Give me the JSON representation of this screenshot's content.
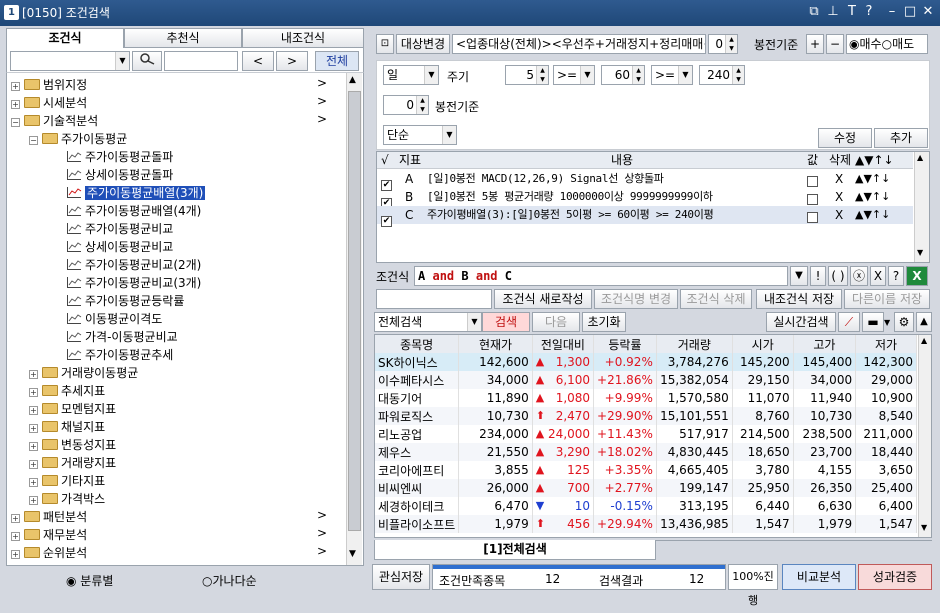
{
  "window": {
    "icon": "1",
    "title": "[0150] 조건검색",
    "buttons": [
      "⧉",
      "⊥",
      "T",
      "?",
      "–",
      "□",
      "✕"
    ]
  },
  "left": {
    "tabs": [
      "조건식",
      "추천식",
      "내조건식"
    ],
    "prev_label": "<",
    "next_label": ">",
    "all_label": "전체",
    "tree": [
      {
        "label": "범위지정",
        "level": 0,
        "type": "folder",
        "exp": "+",
        "arrow": ">"
      },
      {
        "label": "시세분석",
        "level": 0,
        "type": "folder",
        "exp": "+",
        "arrow": ">"
      },
      {
        "label": "기술적분석",
        "level": 0,
        "type": "folder",
        "exp": "−",
        "arrow": ">"
      },
      {
        "label": "주가이동평균",
        "level": 1,
        "type": "folder",
        "exp": "−"
      },
      {
        "label": "주가이동평균돌파",
        "level": 2,
        "type": "item"
      },
      {
        "label": "상세이동평균돌파",
        "level": 2,
        "type": "item"
      },
      {
        "label": "주가이동평균배열(3개)",
        "level": 2,
        "type": "item",
        "selected": true
      },
      {
        "label": "주가이동평균배열(4개)",
        "level": 2,
        "type": "item"
      },
      {
        "label": "주가이동평균비교",
        "level": 2,
        "type": "item"
      },
      {
        "label": "상세이동평균비교",
        "level": 2,
        "type": "item"
      },
      {
        "label": "주가이동평균비교(2개)",
        "level": 2,
        "type": "item"
      },
      {
        "label": "주가이동평균비교(3개)",
        "level": 2,
        "type": "item"
      },
      {
        "label": "주가이동평균등락률",
        "level": 2,
        "type": "item"
      },
      {
        "label": "이동평균이격도",
        "level": 2,
        "type": "item"
      },
      {
        "label": "가격-이동평균비교",
        "level": 2,
        "type": "item"
      },
      {
        "label": "주가이동평균추세",
        "level": 2,
        "type": "item"
      },
      {
        "label": "거래량이동평균",
        "level": 1,
        "type": "folder",
        "exp": "+"
      },
      {
        "label": "추세지표",
        "level": 1,
        "type": "folder",
        "exp": "+"
      },
      {
        "label": "모멘텀지표",
        "level": 1,
        "type": "folder",
        "exp": "+"
      },
      {
        "label": "채널지표",
        "level": 1,
        "type": "folder",
        "exp": "+"
      },
      {
        "label": "변동성지표",
        "level": 1,
        "type": "folder",
        "exp": "+"
      },
      {
        "label": "거래량지표",
        "level": 1,
        "type": "folder",
        "exp": "+"
      },
      {
        "label": "기타지표",
        "level": 1,
        "type": "folder",
        "exp": "+"
      },
      {
        "label": "가격박스",
        "level": 1,
        "type": "folder",
        "exp": "+"
      },
      {
        "label": "패턴분석",
        "level": 0,
        "type": "folder",
        "exp": "+",
        "arrow": ">"
      },
      {
        "label": "재무분석",
        "level": 0,
        "type": "folder",
        "exp": "+",
        "arrow": ">"
      },
      {
        "label": "순위분석",
        "level": 0,
        "type": "folder",
        "exp": "+",
        "arrow": ">"
      }
    ],
    "radio1": "분류별",
    "radio2": "가나다순"
  },
  "right": {
    "scope_btn": "대상변경",
    "scope_text": "<업종대상(전체)><우선주+거래정지+정리매매+",
    "scope_num": "0",
    "scope_basis": "봉전기준",
    "plus": "+",
    "minus": "−",
    "buy": "매수",
    "sell": "매도",
    "period_sel": "일",
    "period_label": "주기",
    "ma1": "5",
    "op1": ">=",
    "ma2": "60",
    "op2": ">=",
    "ma3": "240",
    "offset": "0",
    "offset_label": "봉전기준",
    "type_sel": "단순",
    "edit_btn": "수정",
    "add_btn": "추가",
    "cond_headers": [
      "√",
      "지표",
      "내용",
      "값",
      "삭제",
      "▲▼↑↓"
    ],
    "conditions": [
      {
        "id": "A",
        "text": "[일]0봉전 MACD(12,26,9) Signal선 상향돌파",
        "del": "X",
        "sel": false
      },
      {
        "id": "B",
        "text": "[일]0봉전 5봉 평균거래량 1000000이상 9999999999이하",
        "del": "X",
        "sel": false
      },
      {
        "id": "C",
        "text": "주가이평배열(3):[일]0봉전 5이평 >= 60이평 >= 240이평",
        "del": "X",
        "sel": true
      }
    ],
    "formula_label": "조건식",
    "formula": "A and B and C",
    "f_btns": [
      "▼",
      "!",
      "( )",
      "ⓧ",
      "X",
      "?"
    ],
    "act_btns": [
      "조건식 새로작성",
      "조건식명 변경",
      "조건식 삭제",
      "내조건식 저장",
      "다른이름 저장"
    ],
    "search_scope": "전체검색",
    "search_btn": "검색",
    "next_btn": "다음",
    "reset_btn": "초기화",
    "realtime_btn": "실시간검색",
    "table_headers": [
      "종목명",
      "현재가",
      "전일대비",
      "등락률",
      "거래량",
      "시가",
      "고가",
      "저가"
    ],
    "rows": [
      {
        "name": "SK하이닉스",
        "price": "142,600",
        "arrow": "▲",
        "diff": "1,300",
        "rate": "+0.92%",
        "vol": "3,784,276",
        "open": "145,200",
        "high": "145,400",
        "low": "142,300",
        "up": true,
        "limit": false
      },
      {
        "name": "이수페타시스",
        "price": "34,000",
        "arrow": "▲",
        "diff": "6,100",
        "rate": "+21.86%",
        "vol": "15,382,054",
        "open": "29,150",
        "high": "34,000",
        "low": "29,000",
        "up": true,
        "limit": false
      },
      {
        "name": "대동기어",
        "price": "11,890",
        "arrow": "▲",
        "diff": "1,080",
        "rate": "+9.99%",
        "vol": "1,570,580",
        "open": "11,070",
        "high": "11,940",
        "low": "10,900",
        "up": true,
        "limit": false
      },
      {
        "name": "파워로직스",
        "price": "10,730",
        "arrow": "⬆",
        "diff": "2,470",
        "rate": "+29.90%",
        "vol": "15,101,551",
        "open": "8,760",
        "high": "10,730",
        "low": "8,540",
        "up": true,
        "limit": true
      },
      {
        "name": "리노공업",
        "price": "234,000",
        "arrow": "▲",
        "diff": "24,000",
        "rate": "+11.43%",
        "vol": "517,917",
        "open": "214,500",
        "high": "238,500",
        "low": "211,000",
        "up": true,
        "limit": false
      },
      {
        "name": "제우스",
        "price": "21,550",
        "arrow": "▲",
        "diff": "3,290",
        "rate": "+18.02%",
        "vol": "4,830,445",
        "open": "18,650",
        "high": "23,700",
        "low": "18,440",
        "up": true,
        "limit": false
      },
      {
        "name": "코리아에프티",
        "price": "3,855",
        "arrow": "▲",
        "diff": "125",
        "rate": "+3.35%",
        "vol": "4,665,405",
        "open": "3,780",
        "high": "4,155",
        "low": "3,650",
        "up": true,
        "limit": false
      },
      {
        "name": "비씨엔씨",
        "price": "26,000",
        "arrow": "▲",
        "diff": "700",
        "rate": "+2.77%",
        "vol": "199,147",
        "open": "25,950",
        "high": "26,350",
        "low": "25,400",
        "up": true,
        "limit": false
      },
      {
        "name": "세경하이테크",
        "price": "6,470",
        "arrow": "▼",
        "diff": "10",
        "rate": "-0.15%",
        "vol": "313,195",
        "open": "6,440",
        "high": "6,630",
        "low": "6,400",
        "up": false,
        "limit": false
      },
      {
        "name": "비플라이소프트",
        "price": "1,979",
        "arrow": "⬆",
        "diff": "456",
        "rate": "+29.94%",
        "vol": "13,436,985",
        "open": "1,547",
        "high": "1,979",
        "low": "1,547",
        "up": true,
        "limit": true
      }
    ],
    "bottom_tab": "[1]전체검색",
    "fav_btn": "관심저장",
    "match_label": "조건만족종목",
    "match_count": "12",
    "result_label": "검색결과",
    "result_count": "12",
    "progress": "100%진행",
    "compare_btn": "비교분석",
    "perf_btn": "성과검증"
  }
}
